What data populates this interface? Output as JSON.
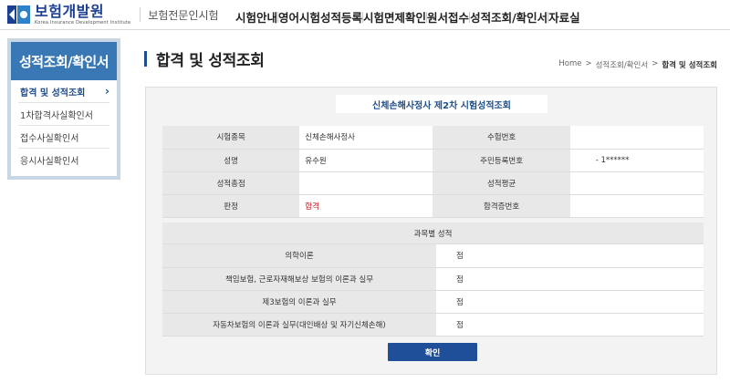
{
  "header": {
    "logo_name": "보험개발원",
    "logo_sub": "Korea Insurance Development Institute",
    "site_name": "보험전문인시험",
    "nav": [
      "시험안내",
      "영어시험성적등록",
      "시험면제확인",
      "원서접수",
      "성적조회/확인서",
      "자료실"
    ]
  },
  "sidebar": {
    "title": "성적조회/확인서",
    "items": [
      {
        "label": "합격 및 성적조회",
        "active": true
      },
      {
        "label": "1차합격사실확인서"
      },
      {
        "label": "접수사실확인서"
      },
      {
        "label": "응시사실확인서"
      }
    ]
  },
  "page": {
    "title": "합격 및 성적조회",
    "breadcrumb": [
      "Home",
      ">",
      "성적조회/확인서",
      ">",
      "합격 및 성적조회"
    ]
  },
  "result": {
    "heading": "신체손해사정사 제2차 시험성적조회",
    "rows": [
      {
        "label1": "시험종목",
        "value1": "신체손해사정사",
        "label2": "수험번호",
        "value2": ""
      },
      {
        "label1": "성명",
        "value1": "유수원",
        "label2": "주민등록번호",
        "value2": "- 1******"
      },
      {
        "label1": "성적총점",
        "value1": "",
        "label2": "성적평균",
        "value2": ""
      },
      {
        "label1": "판정",
        "value1": "합격",
        "label2": "합격증번호",
        "value2": ""
      }
    ],
    "scores_heading": "과목별 성적",
    "scores": [
      {
        "subject": "의학이론",
        "score": "점"
      },
      {
        "subject": "책임보험, 근로자재해보상 보험의 이론과 실무",
        "score": "점"
      },
      {
        "subject": "제3보험의 이론과 실무",
        "score": "점"
      },
      {
        "subject": "자동차보험의 이론과 실무(대인배상 및 자기신체손해)",
        "score": "점"
      }
    ],
    "confirm_label": "확인"
  },
  "colors": {
    "brand": "#1f4e8a",
    "sidebar_title_bg": "#3a78b5",
    "pass_text": "#c0171f",
    "button_bg": "#1e4f98"
  }
}
